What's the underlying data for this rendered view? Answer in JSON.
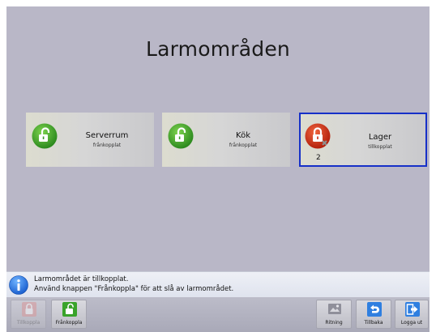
{
  "title": "Larmområden",
  "areas": [
    {
      "name": "Serverrum",
      "state": "frånkopplat",
      "lock": "unlocked-lock-icon",
      "color": "#3a9a2c",
      "count": "",
      "selected": false
    },
    {
      "name": "Kök",
      "state": "frånkopplat",
      "lock": "unlocked-lock-icon",
      "color": "#3a9a2c",
      "count": "",
      "selected": false
    },
    {
      "name": "Lager",
      "state": "tillkopplat",
      "lock": "locked-alarm-icon",
      "color": "#cc2b14",
      "count": "2",
      "selected": true
    }
  ],
  "info": {
    "line1": "Larmområdet är tillkopplat.",
    "line2": "Använd knappen \"Frånkoppla\" för att slå av larmområdet."
  },
  "toolbar": {
    "tillkoppla": "Tillkoppla",
    "frankoppla": "Frånkoppla",
    "ritning": "Ritning",
    "tillbaka": "Tillbaka",
    "loggaut": "Logga ut"
  },
  "colors": {
    "background": "#b9b7c7",
    "selected_border": "#1630c8",
    "unlocked": "#3a9a2c",
    "locked": "#cc2b14"
  }
}
